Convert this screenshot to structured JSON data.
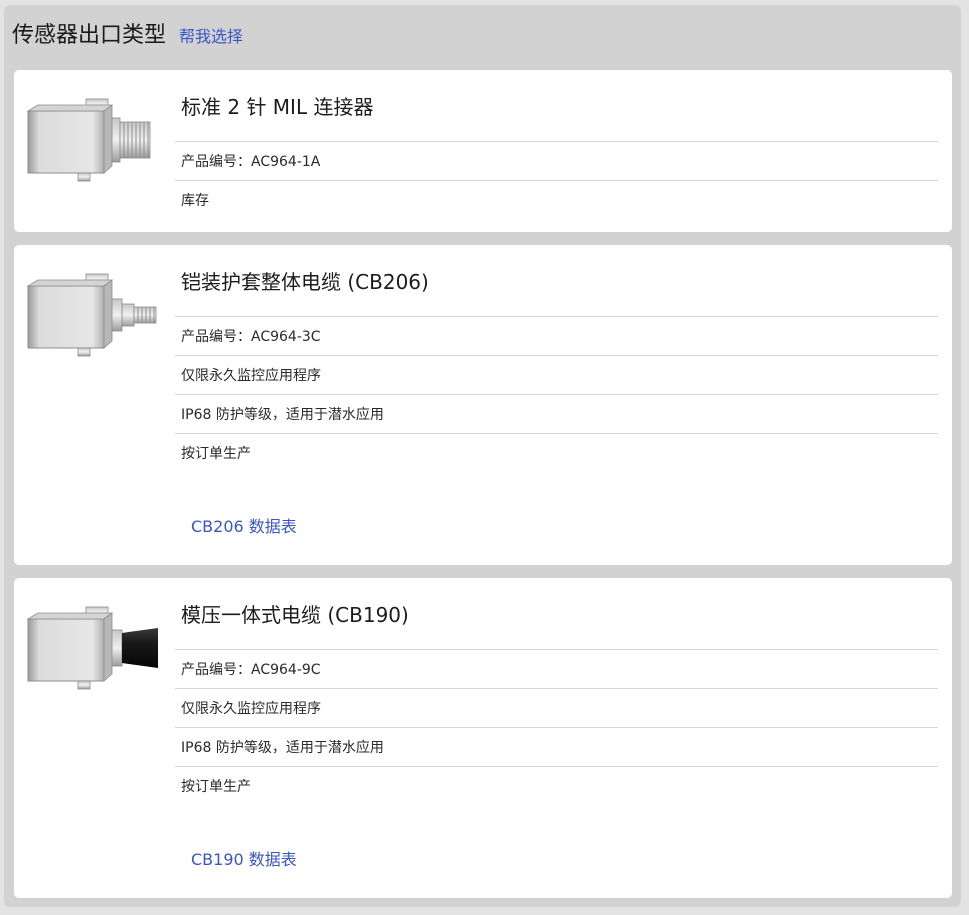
{
  "header": {
    "title": "传感器出口类型",
    "help_link": "帮我选择"
  },
  "products": [
    {
      "name": "标准 2 针 MIL 连接器",
      "part_number": "产品编号：AC964-1A",
      "rows": [
        "库存"
      ],
      "datasheet": ""
    },
    {
      "name": "铠装护套整体电缆 (CB206)",
      "part_number": "产品编号：AC964-3C",
      "rows": [
        "仅限永久监控应用程序",
        "IP68 防护等级，适用于潜水应用",
        "按订单生产"
      ],
      "datasheet": "CB206 数据表"
    },
    {
      "name": "模压一体式电缆 (CB190)",
      "part_number": "产品编号：AC964-9C",
      "rows": [
        "仅限永久监控应用程序",
        "IP68 防护等级，适用于潜水应用",
        "按订单生产"
      ],
      "datasheet": "CB190 数据表"
    }
  ]
}
